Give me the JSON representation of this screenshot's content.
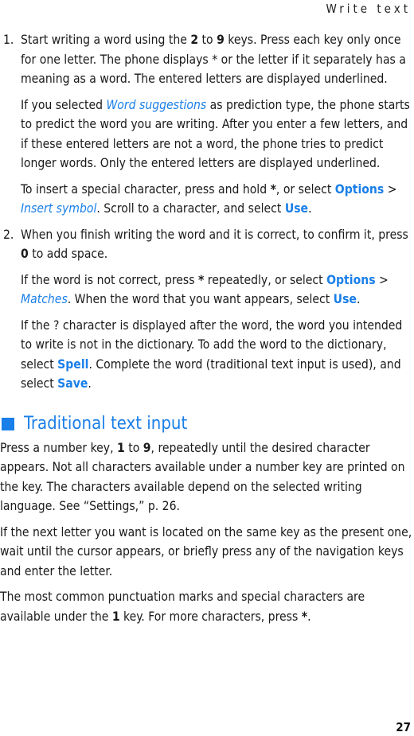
{
  "header": {
    "title": "Write text"
  },
  "steps": [
    {
      "num": "1.",
      "paras": [
        [
          "Start writing a word using the ",
          {
            "b": "2"
          },
          " to ",
          {
            "b": "9"
          },
          " keys. Press each key only once for one letter. The phone displays * or the letter if it separately has a meaning as a word. The entered letters are displayed underlined."
        ],
        [
          "If you selected ",
          {
            "it": "Word suggestions"
          },
          " as prediction type, the phone starts to predict the word you are writing. After you enter a few letters, and if these entered letters are not a word, the phone tries to predict longer words. Only the entered letters are displayed underlined."
        ],
        [
          "To insert a special character, press and hold ",
          {
            "b": "*"
          },
          ", or select ",
          {
            "hl": "Options"
          },
          " > ",
          {
            "it": "Insert symbol"
          },
          ". Scroll to a character, and select ",
          {
            "hl": "Use"
          },
          "."
        ]
      ]
    },
    {
      "num": "2.",
      "paras": [
        [
          "When you finish writing the word and it is correct, to confirm it, press ",
          {
            "b": "0"
          },
          " to add space."
        ],
        [
          "If the word is not correct, press ",
          {
            "b": "*"
          },
          " repeatedly, or select ",
          {
            "hl": "Options"
          },
          " > ",
          {
            "it": "Matches"
          },
          ". When the word that you want appears, select ",
          {
            "hl": "Use"
          },
          "."
        ],
        [
          "If the ? character is displayed after the word, the word you intended to write is not in the dictionary. To add the word to the dictionary, select ",
          {
            "hl": "Spell"
          },
          ". Complete the word (traditional text input is used), and select ",
          {
            "hl": "Save"
          },
          "."
        ]
      ]
    }
  ],
  "section": {
    "title": "Traditional text input",
    "paras": [
      [
        "Press a number key, ",
        {
          "b": "1"
        },
        " to ",
        {
          "b": "9"
        },
        ", repeatedly until the desired character appears. Not all characters available under a number key are printed on the key. The characters available depend on the selected writing language. See “Settings,” p. 26."
      ],
      [
        "If the next letter you want is located on the same key as the present one, wait until the cursor appears, or briefly press any of the navigation keys and enter the letter."
      ],
      [
        "The most common punctuation marks and special characters are available under the ",
        {
          "b": "1"
        },
        " key. For more characters, press ",
        {
          "b": "*"
        },
        "."
      ]
    ]
  },
  "footer": {
    "page_number": "27"
  },
  "colors": {
    "accent": "#1a7fe8"
  }
}
